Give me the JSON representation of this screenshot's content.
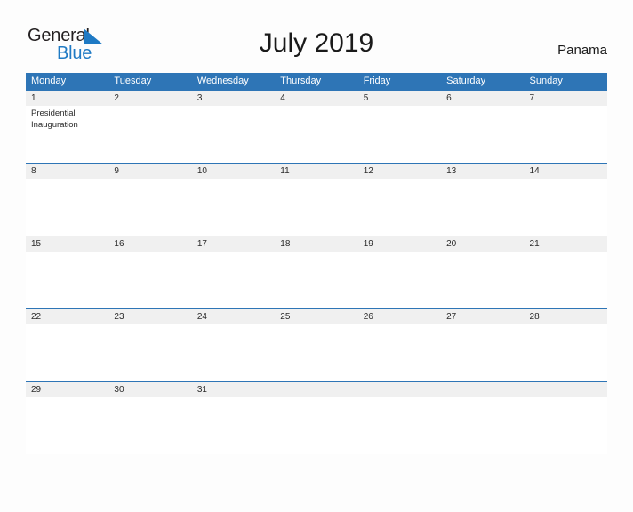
{
  "brand": {
    "name_part1": "General",
    "name_part2": "Blue",
    "accent_color": "#1f7ac4"
  },
  "header": {
    "title": "July 2019",
    "locale": "Panama"
  },
  "calendar": {
    "header_color": "#2e75b6",
    "date_strip_color": "#f0f0f0",
    "weekdays": [
      "Monday",
      "Tuesday",
      "Wednesday",
      "Thursday",
      "Friday",
      "Saturday",
      "Sunday"
    ],
    "weeks": [
      {
        "days": [
          {
            "date": "1",
            "events": [
              "Presidential Inauguration"
            ]
          },
          {
            "date": "2",
            "events": []
          },
          {
            "date": "3",
            "events": []
          },
          {
            "date": "4",
            "events": []
          },
          {
            "date": "5",
            "events": []
          },
          {
            "date": "6",
            "events": []
          },
          {
            "date": "7",
            "events": []
          }
        ]
      },
      {
        "days": [
          {
            "date": "8",
            "events": []
          },
          {
            "date": "9",
            "events": []
          },
          {
            "date": "10",
            "events": []
          },
          {
            "date": "11",
            "events": []
          },
          {
            "date": "12",
            "events": []
          },
          {
            "date": "13",
            "events": []
          },
          {
            "date": "14",
            "events": []
          }
        ]
      },
      {
        "days": [
          {
            "date": "15",
            "events": []
          },
          {
            "date": "16",
            "events": []
          },
          {
            "date": "17",
            "events": []
          },
          {
            "date": "18",
            "events": []
          },
          {
            "date": "19",
            "events": []
          },
          {
            "date": "20",
            "events": []
          },
          {
            "date": "21",
            "events": []
          }
        ]
      },
      {
        "days": [
          {
            "date": "22",
            "events": []
          },
          {
            "date": "23",
            "events": []
          },
          {
            "date": "24",
            "events": []
          },
          {
            "date": "25",
            "events": []
          },
          {
            "date": "26",
            "events": []
          },
          {
            "date": "27",
            "events": []
          },
          {
            "date": "28",
            "events": []
          }
        ]
      },
      {
        "days": [
          {
            "date": "29",
            "events": []
          },
          {
            "date": "30",
            "events": []
          },
          {
            "date": "31",
            "events": []
          },
          {
            "date": "",
            "events": []
          },
          {
            "date": "",
            "events": []
          },
          {
            "date": "",
            "events": []
          },
          {
            "date": "",
            "events": []
          }
        ]
      }
    ]
  }
}
